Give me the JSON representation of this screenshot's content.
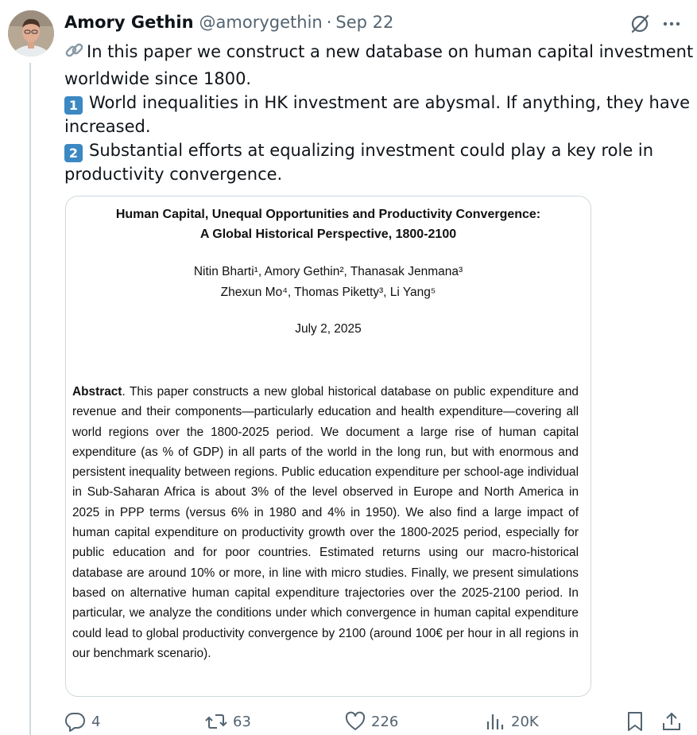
{
  "author": {
    "name": "Amory Gethin",
    "handle": "@amorygethin",
    "separator": "·",
    "date": "Sep 22"
  },
  "tweet": {
    "line1": "In this paper we construct a new database on human capital investment",
    "line2": "worldwide since 1800.",
    "line3": "World inequalities in HK investment are abysmal. If anything, they have",
    "line4": "increased.",
    "line5": "Substantial efforts at equalizing investment could play a key role in",
    "line6": "productivity convergence.",
    "key1": "1",
    "key2": "2"
  },
  "paper": {
    "title_line1": "Human Capital, Unequal Opportunities and Productivity Convergence:",
    "title_line2": "A Global Historical Perspective, 1800-2100",
    "authors_line1": "Nitin Bharti¹, Amory Gethin², Thanasak Jenmana³",
    "authors_line2": "Zhexun Mo⁴, Thomas Piketty³, Li Yang⁵",
    "date": "July 2, 2025",
    "abstract_label": "Abstract",
    "abstract_text": ". This paper constructs a new global historical database on public expenditure and revenue and their components—particularly education and health expenditure—covering all world regions over the 1800-2025 period. We document a large rise of human capital expenditure (as % of GDP) in all parts of the world in the long run, but with enormous and persistent inequality between regions. Public education expenditure per school-age individual in Sub-Saharan Africa is about 3% of the level observed in Europe and North America in 2025 in PPP terms (versus 6% in 1980 and 4% in 1950). We also find a large impact of human capital expenditure on productivity growth over the 1800-2025 period, especially for public education and for poor countries. Estimated returns using our macro-historical database are around 10% or more, in line with micro studies. Finally, we present simulations based on alternative human capital expenditure trajectories over the 2025-2100 period. In particular, we analyze the conditions under which convergence in human capital expenditure could lead to global productivity convergence by 2100 (around 100€ per hour in all regions in our benchmark scenario)."
  },
  "actions": {
    "replies": "4",
    "reposts": "63",
    "likes": "226",
    "views": "20K"
  },
  "colors": {
    "text": "#0f1419",
    "muted": "#536471",
    "border": "#cfd9de",
    "keycap": "#3b88c3"
  },
  "icons": [
    "reply-icon",
    "repost-icon",
    "like-icon",
    "views-icon",
    "bookmark-icon",
    "share-icon",
    "grok-icon",
    "more-icon",
    "link-icon"
  ]
}
